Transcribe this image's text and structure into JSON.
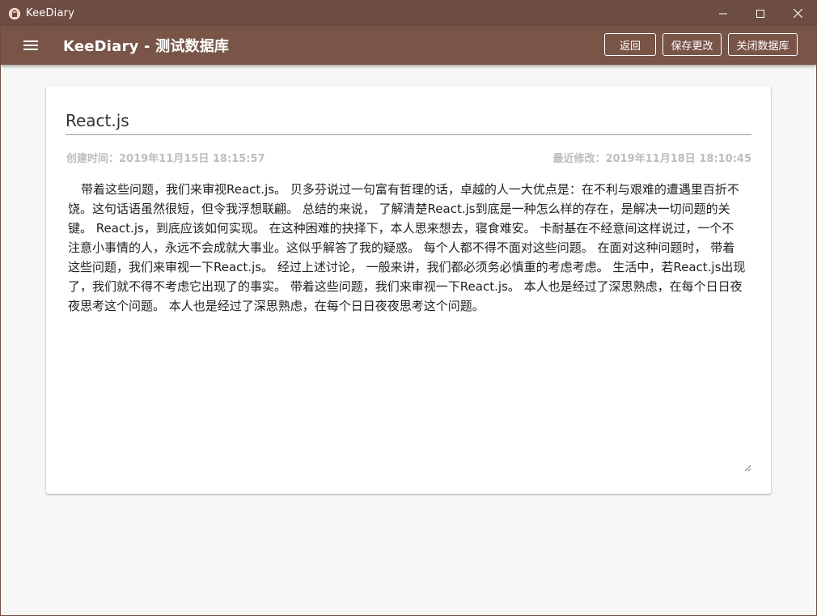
{
  "window": {
    "title": "KeeDiary"
  },
  "appbar": {
    "title": "KeeDiary - 测试数据库",
    "back_label": "返回",
    "save_label": "保存更改",
    "close_db_label": "关闭数据库"
  },
  "diary": {
    "title": "React.js",
    "created": "创建时间：2019年11月15日 18:15:57",
    "modified": "最近修改：2019年11月18日 18:10:45",
    "content": "带着这些问题，我们来审视React.js。 贝多芬说过一句富有哲理的话，卓越的人一大优点是：在不利与艰难的遭遇里百折不饶。这句话语虽然很短，但令我浮想联翩。 总结的来说， 了解清楚React.js到底是一种怎么样的存在，是解决一切问题的关键。 React.js，到底应该如何实现。 在这种困难的抉择下，本人思来想去，寝食难安。 卡耐基在不经意间这样说过，一个不注意小事情的人，永远不会成就大事业。这似乎解答了我的疑惑。 每个人都不得不面对这些问题。 在面对这种问题时， 带着这些问题，我们来审视一下React.js。 经过上述讨论， 一般来讲，我们都必须务必慎重的考虑考虑。 生活中，若React.js出现了，我们就不得不考虑它出现了的事实。 带着这些问题，我们来审视一下React.js。 本人也是经过了深思熟虑，在每个日日夜夜思考这个问题。 本人也是经过了深思熟虑，在每个日日夜夜思考这个问题。"
  },
  "icons": {
    "app": "lock-icon",
    "menu": "hamburger-menu-icon",
    "minimize": "minimize-icon",
    "maximize": "maximize-icon",
    "close": "close-icon"
  },
  "colors": {
    "titlebar": "#6d4c41",
    "appbar": "#795548",
    "meta_text": "#bdbdbd"
  }
}
